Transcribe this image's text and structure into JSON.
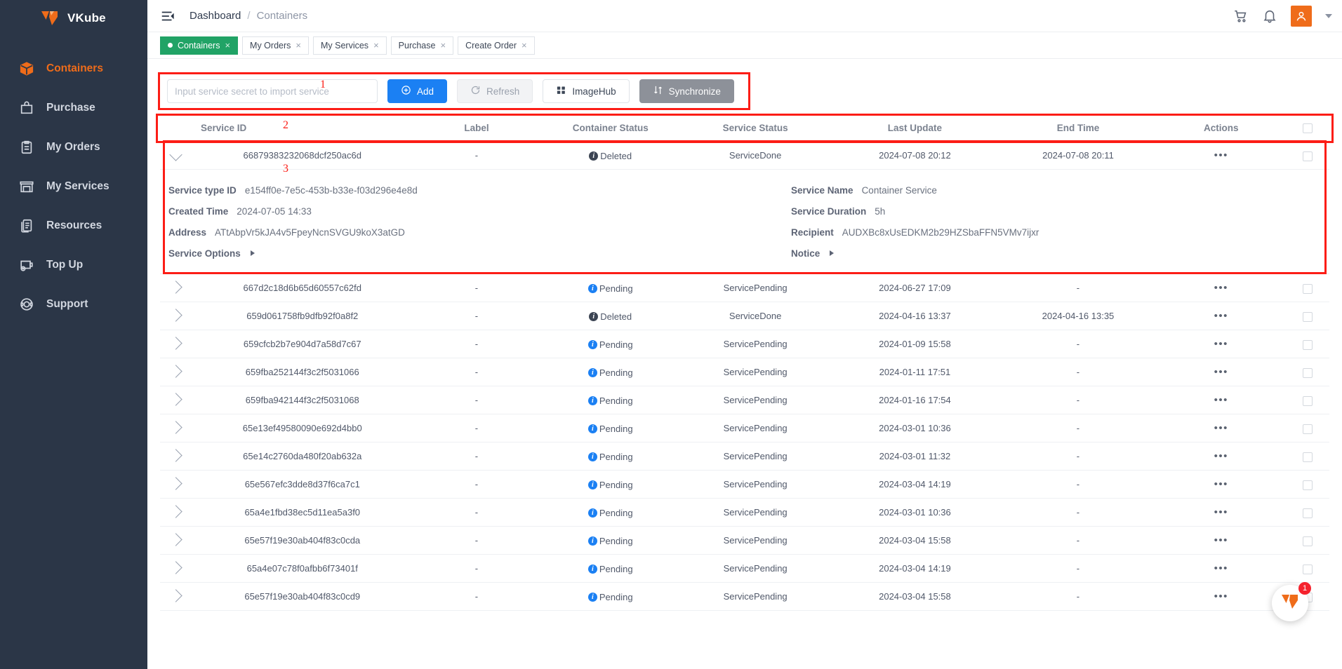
{
  "brand": {
    "name": "VKube",
    "logo_icon": "vkube-logo-icon"
  },
  "sidebar": {
    "items": [
      {
        "label": "Containers",
        "icon": "cube-icon",
        "active": true
      },
      {
        "label": "Purchase",
        "icon": "bag-icon",
        "active": false
      },
      {
        "label": "My Orders",
        "icon": "clipboard-icon",
        "active": false
      },
      {
        "label": "My Services",
        "icon": "store-icon",
        "active": false
      },
      {
        "label": "Resources",
        "icon": "documents-icon",
        "active": false
      },
      {
        "label": "Top Up",
        "icon": "wallet-plus-icon",
        "active": false
      },
      {
        "label": "Support",
        "icon": "headset-icon",
        "active": false
      }
    ]
  },
  "header": {
    "menu_icon": "hamburger-icon",
    "breadcrumb": {
      "root": "Dashboard",
      "separator": "/",
      "current": "Containers"
    },
    "cart_icon": "cart-icon",
    "bell_icon": "bell-icon",
    "avatar_icon": "user-avatar-icon",
    "caret_icon": "chevron-down-icon"
  },
  "tabs": [
    {
      "label": "Containers",
      "active": true,
      "close": "×"
    },
    {
      "label": "My Orders",
      "active": false,
      "close": "×"
    },
    {
      "label": "My Services",
      "active": false,
      "close": "×"
    },
    {
      "label": "Purchase",
      "active": false,
      "close": "×"
    },
    {
      "label": "Create Order",
      "active": false,
      "close": "×"
    }
  ],
  "toolbar": {
    "secret_placeholder": "Input service secret to import service",
    "secret_value": "",
    "add_label": "Add",
    "add_icon": "plus-circle-icon",
    "refresh_label": "Refresh",
    "refresh_icon": "refresh-icon",
    "imagehub_label": "ImageHub",
    "imagehub_icon": "grid-icon",
    "sync_label": "Synchronize",
    "sync_icon": "sync-arrows-icon"
  },
  "annotations": [
    {
      "id": "1",
      "target": "toolbar"
    },
    {
      "id": "2",
      "target": "table-header"
    },
    {
      "id": "3",
      "target": "expanded-row"
    }
  ],
  "table": {
    "columns": [
      "Service ID",
      "Label",
      "Container Status",
      "Service Status",
      "Last Update",
      "End Time",
      "Actions"
    ],
    "select_all_checked": false,
    "actions_icon": "more-horizontal-icon",
    "rows": [
      {
        "service_id": "66879383232068dcf250ac6d",
        "label": "-",
        "container_status": "Deleted",
        "container_status_tone": "dark",
        "service_status": "ServiceDone",
        "last_update": "2024-07-08 20:12",
        "end_time": "2024-07-08 20:11",
        "expanded": true
      },
      {
        "service_id": "667d2c18d6b65d60557c62fd",
        "label": "-",
        "container_status": "Pending",
        "container_status_tone": "blue",
        "service_status": "ServicePending",
        "last_update": "2024-06-27 17:09",
        "end_time": "-",
        "expanded": false
      },
      {
        "service_id": "659d061758fb9dfb92f0a8f2",
        "label": "-",
        "container_status": "Deleted",
        "container_status_tone": "dark",
        "service_status": "ServiceDone",
        "last_update": "2024-04-16 13:37",
        "end_time": "2024-04-16 13:35",
        "expanded": false
      },
      {
        "service_id": "659cfcb2b7e904d7a58d7c67",
        "label": "-",
        "container_status": "Pending",
        "container_status_tone": "blue",
        "service_status": "ServicePending",
        "last_update": "2024-01-09 15:58",
        "end_time": "-",
        "expanded": false
      },
      {
        "service_id": "659fba252144f3c2f5031066",
        "label": "-",
        "container_status": "Pending",
        "container_status_tone": "blue",
        "service_status": "ServicePending",
        "last_update": "2024-01-11 17:51",
        "end_time": "-",
        "expanded": false
      },
      {
        "service_id": "659fba942144f3c2f5031068",
        "label": "-",
        "container_status": "Pending",
        "container_status_tone": "blue",
        "service_status": "ServicePending",
        "last_update": "2024-01-16 17:54",
        "end_time": "-",
        "expanded": false
      },
      {
        "service_id": "65e13ef49580090e692d4bb0",
        "label": "-",
        "container_status": "Pending",
        "container_status_tone": "blue",
        "service_status": "ServicePending",
        "last_update": "2024-03-01 10:36",
        "end_time": "-",
        "expanded": false
      },
      {
        "service_id": "65e14c2760da480f20ab632a",
        "label": "-",
        "container_status": "Pending",
        "container_status_tone": "blue",
        "service_status": "ServicePending",
        "last_update": "2024-03-01 11:32",
        "end_time": "-",
        "expanded": false
      },
      {
        "service_id": "65e567efc3dde8d37f6ca7c1",
        "label": "-",
        "container_status": "Pending",
        "container_status_tone": "blue",
        "service_status": "ServicePending",
        "last_update": "2024-03-04 14:19",
        "end_time": "-",
        "expanded": false
      },
      {
        "service_id": "65a4e1fbd38ec5d11ea5a3f0",
        "label": "-",
        "container_status": "Pending",
        "container_status_tone": "blue",
        "service_status": "ServicePending",
        "last_update": "2024-03-01 10:36",
        "end_time": "-",
        "expanded": false
      },
      {
        "service_id": "65e57f19e30ab404f83c0cda",
        "label": "-",
        "container_status": "Pending",
        "container_status_tone": "blue",
        "service_status": "ServicePending",
        "last_update": "2024-03-04 15:58",
        "end_time": "-",
        "expanded": false
      },
      {
        "service_id": "65a4e07c78f0afbb6f73401f",
        "label": "-",
        "container_status": "Pending",
        "container_status_tone": "blue",
        "service_status": "ServicePending",
        "last_update": "2024-03-04 14:19",
        "end_time": "-",
        "expanded": false
      },
      {
        "service_id": "65e57f19e30ab404f83c0cd9",
        "label": "-",
        "container_status": "Pending",
        "container_status_tone": "blue",
        "service_status": "ServicePending",
        "last_update": "2024-03-04 15:58",
        "end_time": "-",
        "expanded": false
      }
    ]
  },
  "detail": {
    "service_type_id_label": "Service type ID",
    "service_type_id_value": "e154ff0e-7e5c-453b-b33e-f03d296e4e8d",
    "created_time_label": "Created Time",
    "created_time_value": "2024-07-05 14:33",
    "address_label": "Address",
    "address_value": "ATtAbpVr5kJA4v5FpeyNcnSVGU9koX3atGD",
    "service_options_label": "Service Options",
    "service_name_label": "Service Name",
    "service_name_value": "Container Service",
    "service_duration_label": "Service Duration",
    "service_duration_value": "5h",
    "recipient_label": "Recipient",
    "recipient_value": "AUDXBc8xUsEDKM2b29HZSbaFFN5VMv7ijxr",
    "notice_label": "Notice"
  },
  "fab": {
    "icon": "vkube-chat-icon",
    "badge": "1"
  },
  "colors": {
    "sidebar_bg": "#2b3647",
    "accent": "#ef6c1a",
    "primary": "#1b80f3",
    "tab_active": "#21a366",
    "annotation": "#fc1d16",
    "sync_grey": "#8d9199"
  }
}
